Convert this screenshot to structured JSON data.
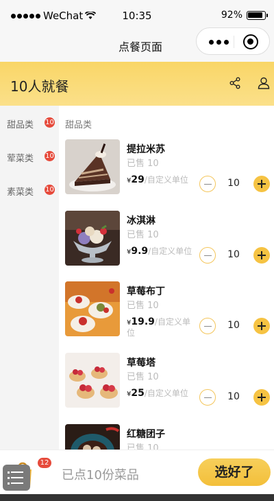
{
  "status_bar": {
    "carrier": "WeChat",
    "time": "10:35",
    "battery": "92%"
  },
  "nav": {
    "title": "点餐页面"
  },
  "header": {
    "title": "10人就餐"
  },
  "sidebar": {
    "items": [
      {
        "label": "甜品类",
        "badge": "10"
      },
      {
        "label": "荤菜类",
        "badge": "10"
      },
      {
        "label": "素菜类",
        "badge": "10"
      }
    ]
  },
  "content": {
    "section_title": "甜品类",
    "foods": [
      {
        "name": "提拉米苏",
        "sold": "已售 10",
        "yen": "¥",
        "price": "29",
        "unit": "/自定义单位",
        "qty": "10"
      },
      {
        "name": "冰淇淋",
        "sold": "已售 10",
        "yen": "¥",
        "price": "9.9",
        "unit": "/自定义单位",
        "qty": "10"
      },
      {
        "name": "草莓布丁",
        "sold": "已售 10",
        "yen": "¥",
        "price": "19.9",
        "unit": "/自定义单位",
        "qty": "10"
      },
      {
        "name": "草莓塔",
        "sold": "已售 10",
        "yen": "¥",
        "price": "25",
        "unit": "/自定义单位",
        "qty": "10"
      },
      {
        "name": "红糖团子",
        "sold": "已售 10",
        "yen": "¥",
        "price": "",
        "unit": "",
        "qty": ""
      }
    ]
  },
  "bottom_bar": {
    "cart_count": "12",
    "order_info": "已点10份菜品",
    "submit_label": "选好了"
  },
  "colors": {
    "accent": "#f6c343",
    "badge": "#e64a3b"
  }
}
